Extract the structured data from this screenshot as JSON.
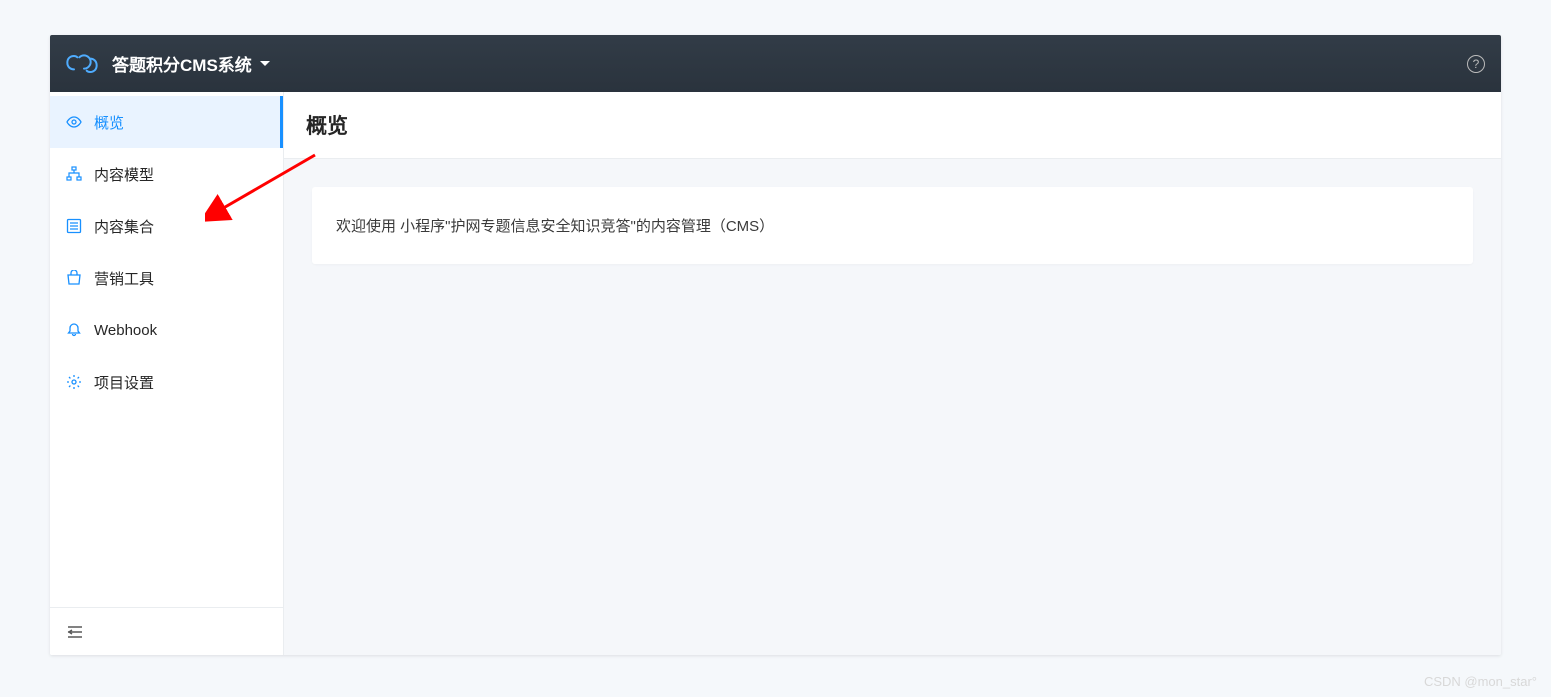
{
  "header": {
    "title": "答题积分CMS系统",
    "help_tooltip": "?"
  },
  "sidebar": {
    "items": [
      {
        "label": "概览",
        "icon": "eye-icon",
        "active": true
      },
      {
        "label": "内容模型",
        "icon": "sitemap-icon",
        "active": false
      },
      {
        "label": "内容集合",
        "icon": "list-icon",
        "active": false
      },
      {
        "label": "营销工具",
        "icon": "bag-icon",
        "active": false
      },
      {
        "label": "Webhook",
        "icon": "bell-icon",
        "active": false
      },
      {
        "label": "项目设置",
        "icon": "gear-icon",
        "active": false
      }
    ]
  },
  "content": {
    "title": "概览",
    "welcome_text": "欢迎使用 小程序\"护网专题信息安全知识竞答\"的内容管理（CMS）"
  },
  "watermark": "CSDN @mon_star°"
}
